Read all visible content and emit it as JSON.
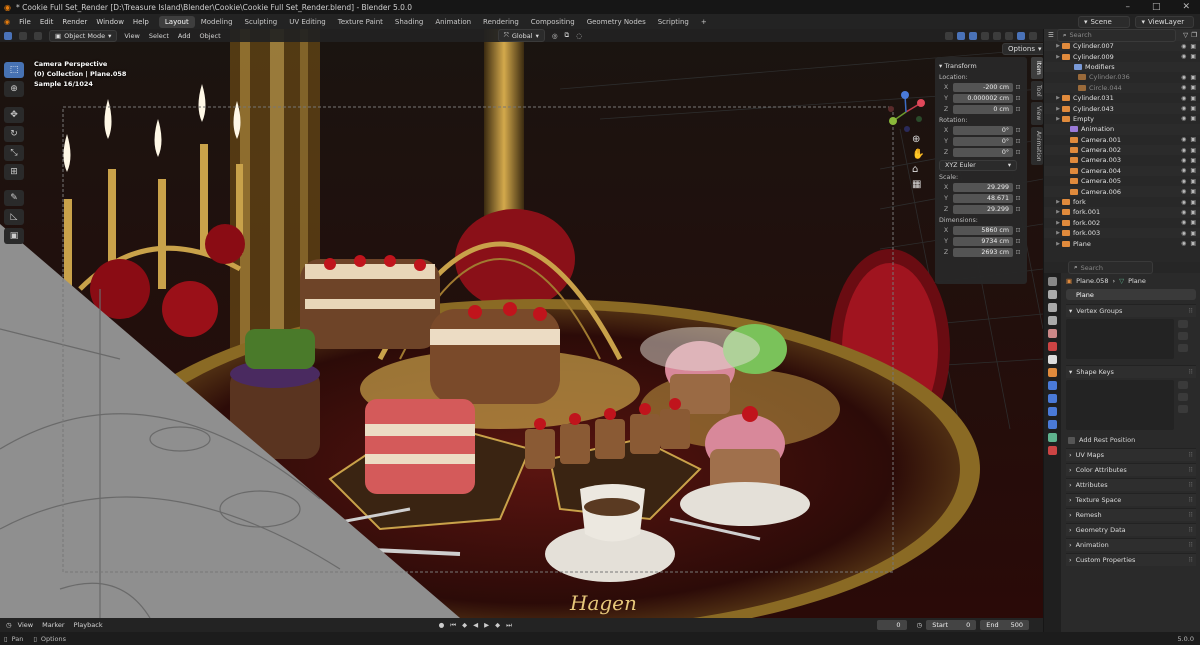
{
  "window": {
    "title": "* Cookie Full Set_Render [D:\\Treasure Island\\Blender\\Cookie\\Cookie Full Set_Render.blend] - Blender 5.0.0"
  },
  "menu": [
    "File",
    "Edit",
    "Render",
    "Window",
    "Help"
  ],
  "workspaces": [
    "Layout",
    "Modeling",
    "Sculpting",
    "UV Editing",
    "Texture Paint",
    "Shading",
    "Animation",
    "Rendering",
    "Compositing",
    "Geometry Nodes",
    "Scripting"
  ],
  "workspace_add": "+",
  "scene": {
    "scene": "Scene",
    "view_layer": "ViewLayer"
  },
  "viewport_header": {
    "mode": "Object Mode",
    "menus": [
      "View",
      "Select",
      "Add",
      "Object"
    ],
    "orientation": "Global",
    "options": "Options"
  },
  "viewport_info": {
    "line1": "Camera Perspective",
    "line2": "(0) Collection | Plane.058",
    "line3": "Sample 16/1024"
  },
  "signature": "Hagen",
  "npanel": {
    "title": "Transform",
    "location_label": "Location:",
    "location": [
      {
        "axis": "X",
        "value": "-200 cm"
      },
      {
        "axis": "Y",
        "value": "0.000002 cm"
      },
      {
        "axis": "Z",
        "value": "0 cm"
      }
    ],
    "rotation_label": "Rotation:",
    "rotation": [
      {
        "axis": "X",
        "value": "0°"
      },
      {
        "axis": "Y",
        "value": "0°"
      },
      {
        "axis": "Z",
        "value": "0°"
      }
    ],
    "rotation_mode": "XYZ Euler",
    "scale_label": "Scale:",
    "scale": [
      {
        "axis": "X",
        "value": "29.299"
      },
      {
        "axis": "Y",
        "value": "48.671"
      },
      {
        "axis": "Z",
        "value": "29.299"
      }
    ],
    "dimensions_label": "Dimensions:",
    "dimensions": [
      {
        "axis": "X",
        "value": "5860 cm"
      },
      {
        "axis": "Y",
        "value": "9734 cm"
      },
      {
        "axis": "Z",
        "value": "2693 cm"
      }
    ],
    "tabs": [
      "Item",
      "Tool",
      "View",
      "Animation"
    ]
  },
  "outliner": {
    "search_placeholder": "Search",
    "rows": [
      {
        "name": "Cylinder.007",
        "type": "mesh"
      },
      {
        "name": "Cylinder.009",
        "type": "mesh"
      },
      {
        "name": "Modifiers",
        "type": "modifier"
      },
      {
        "name": "Cylinder.036",
        "type": "mesh-dim"
      },
      {
        "name": "Circle.044",
        "type": "mesh-dim"
      },
      {
        "name": "Cylinder.031",
        "type": "mesh"
      },
      {
        "name": "Cylinder.043",
        "type": "mesh"
      },
      {
        "name": "Empty",
        "type": "empty"
      },
      {
        "name": "Animation",
        "type": "anim"
      },
      {
        "name": "Camera.001",
        "type": "camera"
      },
      {
        "name": "Camera.002",
        "type": "camera"
      },
      {
        "name": "Camera.003",
        "type": "camera"
      },
      {
        "name": "Camera.004",
        "type": "camera"
      },
      {
        "name": "Camera.005",
        "type": "camera"
      },
      {
        "name": "Camera.006",
        "type": "camera"
      },
      {
        "name": "fork",
        "type": "mesh"
      },
      {
        "name": "fork.001",
        "type": "mesh"
      },
      {
        "name": "fork.002",
        "type": "mesh"
      },
      {
        "name": "fork.003",
        "type": "mesh"
      },
      {
        "name": "Plane",
        "type": "mesh"
      }
    ]
  },
  "properties": {
    "search_placeholder": "Search",
    "object_name": "Plane.058",
    "data_name": "Plane",
    "mesh_name": "Plane",
    "sections": [
      "Vertex Groups",
      "Shape Keys"
    ],
    "add_rest_position": "Add Rest Position",
    "collapsed_sections": [
      "UV Maps",
      "Color Attributes",
      "Attributes",
      "Texture Space",
      "Remesh",
      "Geometry Data",
      "Animation",
      "Custom Properties"
    ]
  },
  "timeline": {
    "menus": [
      "View",
      "Marker",
      "Playback"
    ],
    "current_frame": "0",
    "start_label": "Start",
    "start": "0",
    "end_label": "End",
    "end": "500"
  },
  "status": {
    "pan": "Pan",
    "options": "Options",
    "version": "5.0.0"
  },
  "colors": {
    "accent": "#4772b3",
    "bg": "#1d1d1d",
    "mesh_orange": "#e08a3c",
    "camera_green": "#5fb38e",
    "gold": "#c9a24a"
  }
}
